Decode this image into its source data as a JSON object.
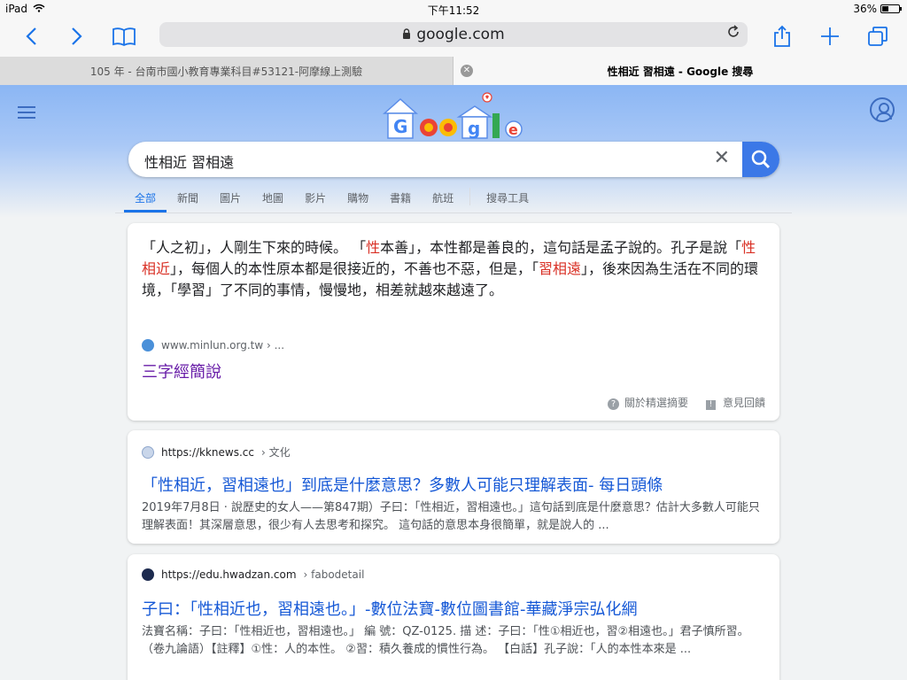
{
  "status_bar": {
    "device": "iPad",
    "time": "下午11:52",
    "battery": "36%",
    "battery_level": 0.36
  },
  "toolbar": {
    "address": "google.com"
  },
  "tabs": [
    {
      "title": "105 年 - 台南市國小教育專業科目#53121-阿摩線上測驗",
      "active": false
    },
    {
      "title": "性相近 習相遠 - Google 搜尋",
      "active": true
    }
  ],
  "search": {
    "query": "性相近 習相遠"
  },
  "nav": {
    "items": [
      "全部",
      "新聞",
      "圖片",
      "地圖",
      "影片",
      "購物",
      "書籍",
      "航班"
    ],
    "tools": "搜尋工具"
  },
  "featured": {
    "snippet_html": "「人之初」，人剛生下來的時候。 「<em>性</em>本善」，本性都是善良的，這句話是孟子說的。孔子是說「<em>性相近</em>」，每個人的本性原本都是很接近的，不善也不惡，但是，「<em>習相遠</em>」，後來因為生活在不同的環境，「學習」了不同的事情，慢慢地，相差就越來越遠了。",
    "source": "www.minlun.org.tw › ...",
    "title": "三字經簡說",
    "about": "關於精選摘要",
    "feedback": "意見回饋"
  },
  "results": [
    {
      "url": "https://kknews.cc",
      "crumb": "› 文化",
      "title": "「性相近，習相遠也」到底是什麼意思？多數人可能只理解表面- 每日頭條",
      "desc": "2019年7月8日 · 說歷史的女人——第847期）子曰：「性相近，習相遠也。」這句話到底是什麼意思？估計大多數人可能只理解表面！其深層意思，很少有人去思考和探究。 這句話的意思本身很簡單，就是說人的 ..."
    },
    {
      "url": "https://edu.hwadzan.com",
      "crumb": "› fabodetail",
      "title": "子曰：「性相近也，習相遠也。」-數位法寶-數位圖書館-華藏淨宗弘化網",
      "desc": "法寶名稱：子曰：「性相近也，習相遠也。」 編 號：QZ-0125. 描 述：子曰：「性①相近也，習②相遠也。」君子慎所習。（卷九論語）【註釋】①性：人的本性。 ②習：積久養成的慣性行為。 【白話】孔子說：「人的本性本來是 ..."
    }
  ]
}
